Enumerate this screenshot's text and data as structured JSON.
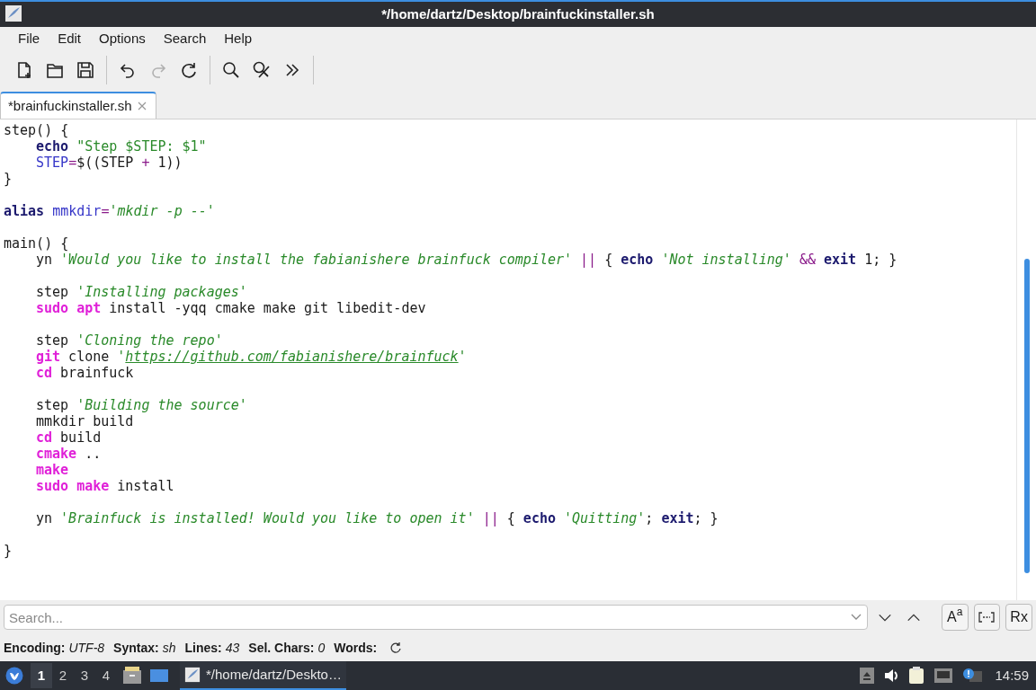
{
  "window": {
    "title": "*/home/dartz/Desktop/brainfuckinstaller.sh"
  },
  "menu": [
    "File",
    "Edit",
    "Options",
    "Search",
    "Help"
  ],
  "toolbar": [
    {
      "kind": "new",
      "disabled": false
    },
    {
      "kind": "open",
      "disabled": false
    },
    {
      "kind": "save",
      "disabled": false
    },
    {
      "kind": "sep"
    },
    {
      "kind": "undo",
      "disabled": false
    },
    {
      "kind": "redo",
      "disabled": true
    },
    {
      "kind": "reload",
      "disabled": false
    },
    {
      "kind": "sep"
    },
    {
      "kind": "find",
      "disabled": false
    },
    {
      "kind": "replace",
      "disabled": false
    },
    {
      "kind": "more",
      "disabled": false
    },
    {
      "kind": "sep"
    }
  ],
  "tabs": [
    {
      "label": "*brainfuckinstaller.sh",
      "selected": true
    }
  ],
  "code": [
    {
      "kind": "code",
      "indented": false,
      "tokens": [
        {
          "text": "step() {",
          "kind": "plain"
        }
      ]
    },
    {
      "kind": "code",
      "indented": true,
      "tokens": [
        {
          "text": "echo ",
          "kind": "keyword"
        },
        {
          "text": "\"Step $STEP: $1\"",
          "kind": "dstring"
        }
      ]
    },
    {
      "kind": "code",
      "indented": true,
      "tokens": [
        {
          "text": "STEP",
          "kind": "var"
        },
        {
          "text": "=",
          "kind": "op"
        },
        {
          "text": "$((STEP ",
          "kind": "plain"
        },
        {
          "text": "+",
          "kind": "op"
        },
        {
          "text": " 1))",
          "kind": "plain"
        }
      ]
    },
    {
      "kind": "code",
      "indented": false,
      "tokens": [
        {
          "text": "}",
          "kind": "plain"
        }
      ]
    },
    {
      "kind": "blank"
    },
    {
      "kind": "code",
      "indented": false,
      "tokens": [
        {
          "text": "alias ",
          "kind": "keyword"
        },
        {
          "text": "mmkdir",
          "kind": "var"
        },
        {
          "text": "=",
          "kind": "op"
        },
        {
          "text": "'mkdir -p --'",
          "kind": "string"
        }
      ]
    },
    {
      "kind": "blank"
    },
    {
      "kind": "code",
      "indented": false,
      "tokens": [
        {
          "text": "main() {",
          "kind": "plain"
        }
      ]
    },
    {
      "kind": "code",
      "indented": true,
      "tokens": [
        {
          "text": "yn ",
          "kind": "plain"
        },
        {
          "text": "'Would you like to install the fabianishere brainfuck compiler' ",
          "kind": "string"
        },
        {
          "text": "|| ",
          "kind": "op"
        },
        {
          "text": "{ ",
          "kind": "plain"
        },
        {
          "text": "echo ",
          "kind": "keyword"
        },
        {
          "text": "'Not installing' ",
          "kind": "string"
        },
        {
          "text": "&& ",
          "kind": "op"
        },
        {
          "text": "exit",
          "kind": "keyword"
        },
        {
          "text": " 1; }",
          "kind": "plain"
        }
      ]
    },
    {
      "kind": "blank"
    },
    {
      "kind": "code",
      "indented": true,
      "tokens": [
        {
          "text": "step ",
          "kind": "plain"
        },
        {
          "text": "'Installing packages'",
          "kind": "string"
        }
      ]
    },
    {
      "kind": "code",
      "indented": true,
      "tokens": [
        {
          "text": "sudo ",
          "kind": "command"
        },
        {
          "text": "apt",
          "kind": "command"
        },
        {
          "text": " install -yqq cmake make git libedit-dev",
          "kind": "plain"
        }
      ]
    },
    {
      "kind": "blank"
    },
    {
      "kind": "code",
      "indented": true,
      "tokens": [
        {
          "text": "step ",
          "kind": "plain"
        },
        {
          "text": "'Cloning the repo'",
          "kind": "string"
        }
      ]
    },
    {
      "kind": "code",
      "indented": true,
      "tokens": [
        {
          "text": "git",
          "kind": "command"
        },
        {
          "text": " clone ",
          "kind": "plain"
        },
        {
          "text": "'",
          "kind": "string"
        },
        {
          "text": "https://github.com/fabianishere/brainfuck",
          "kind": "link"
        },
        {
          "text": "'",
          "kind": "string"
        }
      ]
    },
    {
      "kind": "code",
      "indented": true,
      "tokens": [
        {
          "text": "cd",
          "kind": "command"
        },
        {
          "text": " brainfuck",
          "kind": "plain"
        }
      ]
    },
    {
      "kind": "blank"
    },
    {
      "kind": "code",
      "indented": true,
      "tokens": [
        {
          "text": "step ",
          "kind": "plain"
        },
        {
          "text": "'Building the source'",
          "kind": "string"
        }
      ]
    },
    {
      "kind": "code",
      "indented": true,
      "tokens": [
        {
          "text": "mmkdir build",
          "kind": "plain"
        }
      ]
    },
    {
      "kind": "code",
      "indented": true,
      "tokens": [
        {
          "text": "cd",
          "kind": "command"
        },
        {
          "text": " build",
          "kind": "plain"
        }
      ]
    },
    {
      "kind": "code",
      "indented": true,
      "tokens": [
        {
          "text": "cmake",
          "kind": "command"
        },
        {
          "text": " ..",
          "kind": "plain"
        }
      ]
    },
    {
      "kind": "code",
      "indented": true,
      "tokens": [
        {
          "text": "make",
          "kind": "command"
        }
      ]
    },
    {
      "kind": "code",
      "indented": true,
      "tokens": [
        {
          "text": "sudo ",
          "kind": "command"
        },
        {
          "text": "make",
          "kind": "command"
        },
        {
          "text": " install",
          "kind": "plain"
        }
      ]
    },
    {
      "kind": "blank"
    },
    {
      "kind": "code",
      "indented": true,
      "tokens": [
        {
          "text": "yn ",
          "kind": "plain"
        },
        {
          "text": "'Brainfuck is installed! Would you like to open it' ",
          "kind": "string"
        },
        {
          "text": "|| ",
          "kind": "op"
        },
        {
          "text": "{ ",
          "kind": "plain"
        },
        {
          "text": "echo ",
          "kind": "keyword"
        },
        {
          "text": "'Quitting'",
          "kind": "string"
        },
        {
          "text": "; ",
          "kind": "plain"
        },
        {
          "text": "exit",
          "kind": "keyword"
        },
        {
          "text": "; }",
          "kind": "plain"
        }
      ]
    },
    {
      "kind": "blank"
    },
    {
      "kind": "code",
      "indented": false,
      "tokens": [
        {
          "text": "}",
          "kind": "plain"
        }
      ]
    }
  ],
  "search": {
    "placeholder": "Search...",
    "match_case": {
      "label": "A$^{a}$"
    },
    "regex": {
      "label": "Rx"
    }
  },
  "status": [
    {
      "label": "Encoding:",
      "value": "UTF-8"
    },
    {
      "label": "Syntax:",
      "value": "sh"
    },
    {
      "label": "Lines:",
      "value": "43"
    },
    {
      "label": "Sel. Chars:",
      "value": "0"
    },
    {
      "label": "Words:"
    }
  ],
  "taskbar": {
    "workspaces": [
      {
        "label": "1",
        "selected": true
      },
      {
        "label": "2",
        "selected": false
      },
      {
        "label": "3",
        "selected": false
      },
      {
        "label": "4",
        "selected": false
      }
    ],
    "tasks": [
      {
        "label": "*/home/dartz/Deskto…",
        "selected": true
      }
    ],
    "clock": "14:59"
  }
}
